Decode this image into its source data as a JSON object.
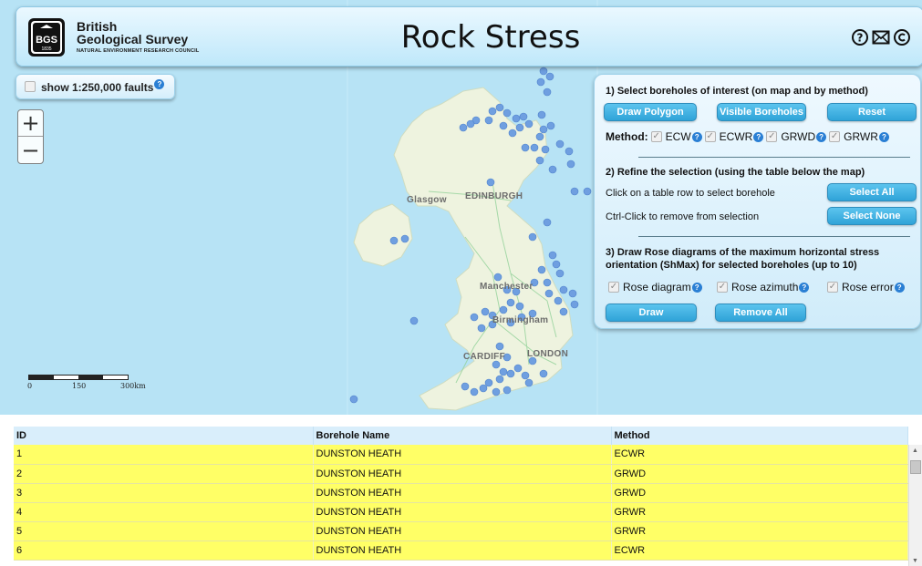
{
  "header": {
    "org_line1": "British",
    "org_line2": "Geological Survey",
    "org_sub": "NATURAL ENVIRONMENT RESEARCH COUNCIL",
    "logo_text": "BGS",
    "logo_year": "1835",
    "title": "Rock Stress",
    "icons": [
      "help-icon",
      "email-icon",
      "copyright-icon"
    ]
  },
  "map": {
    "faults_label": "show 1:250,000 faults",
    "zoom_in": "+",
    "zoom_out": "−",
    "scale": {
      "l0": "0",
      "l1": "150",
      "l2": "300km"
    },
    "places": {
      "glasgow": "Glasgow",
      "edinburgh": "EDINBURGH",
      "manchester": "Manchester",
      "birmingham": "Birmingham",
      "cardiff": "CARDIFF",
      "london": "LONDON"
    },
    "colors": {
      "sea": "#b7e3f5",
      "land": "#eef3df",
      "borehole": "#6f9fe0"
    }
  },
  "panel": {
    "step1_title": "1) Select boreholes of interest (on map and by method)",
    "btn_draw_polygon": "Draw Polygon",
    "btn_visible": "Visible Boreholes",
    "btn_reset": "Reset",
    "method_label": "Method:",
    "methods": [
      "ECW",
      "ECWR",
      "GRWD",
      "GRWR"
    ],
    "step2_title": "2) Refine the selection (using the table below the map)",
    "click_text": "Click on a table row to select borehole",
    "ctrl_text": "Ctrl-Click to remove from selection",
    "btn_select_all": "Select All",
    "btn_select_none": "Select None",
    "step3_title_line1": "3) Draw Rose diagrams of the maximum horizontal stress",
    "step3_title_line2": "orientation (ShMax) for selected boreholes (up to 10)",
    "rose_options": [
      "Rose diagram",
      "Rose azimuth",
      "Rose error"
    ],
    "btn_draw": "Draw",
    "btn_remove_all": "Remove All"
  },
  "table": {
    "headers": [
      "ID",
      "Borehole Name",
      "Method"
    ],
    "rows": [
      [
        "1",
        "DUNSTON HEATH",
        "ECWR"
      ],
      [
        "2",
        "DUNSTON HEATH",
        "GRWD"
      ],
      [
        "3",
        "DUNSTON HEATH",
        "GRWD"
      ],
      [
        "4",
        "DUNSTON HEATH",
        "GRWR"
      ],
      [
        "5",
        "DUNSTON HEATH",
        "GRWR"
      ],
      [
        "6",
        "DUNSTON HEATH",
        "ECWR"
      ]
    ],
    "row_color": "#ffff66"
  }
}
